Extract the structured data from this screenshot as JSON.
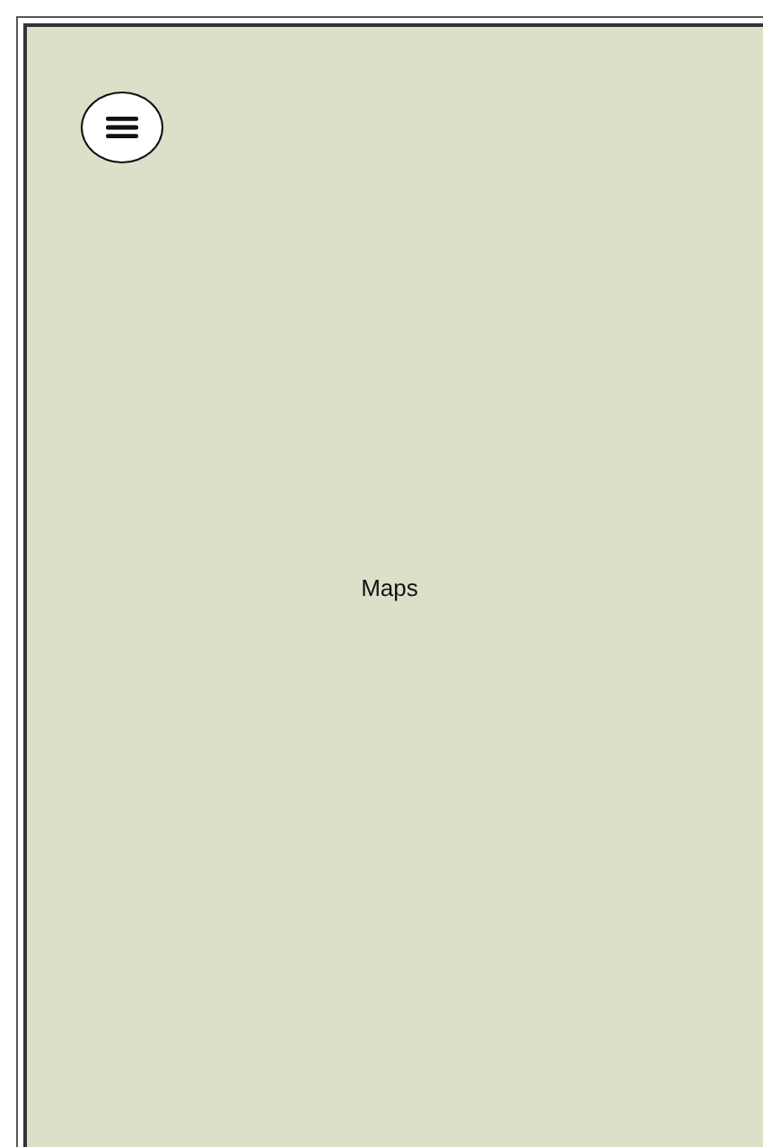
{
  "map": {
    "label": "Maps"
  }
}
